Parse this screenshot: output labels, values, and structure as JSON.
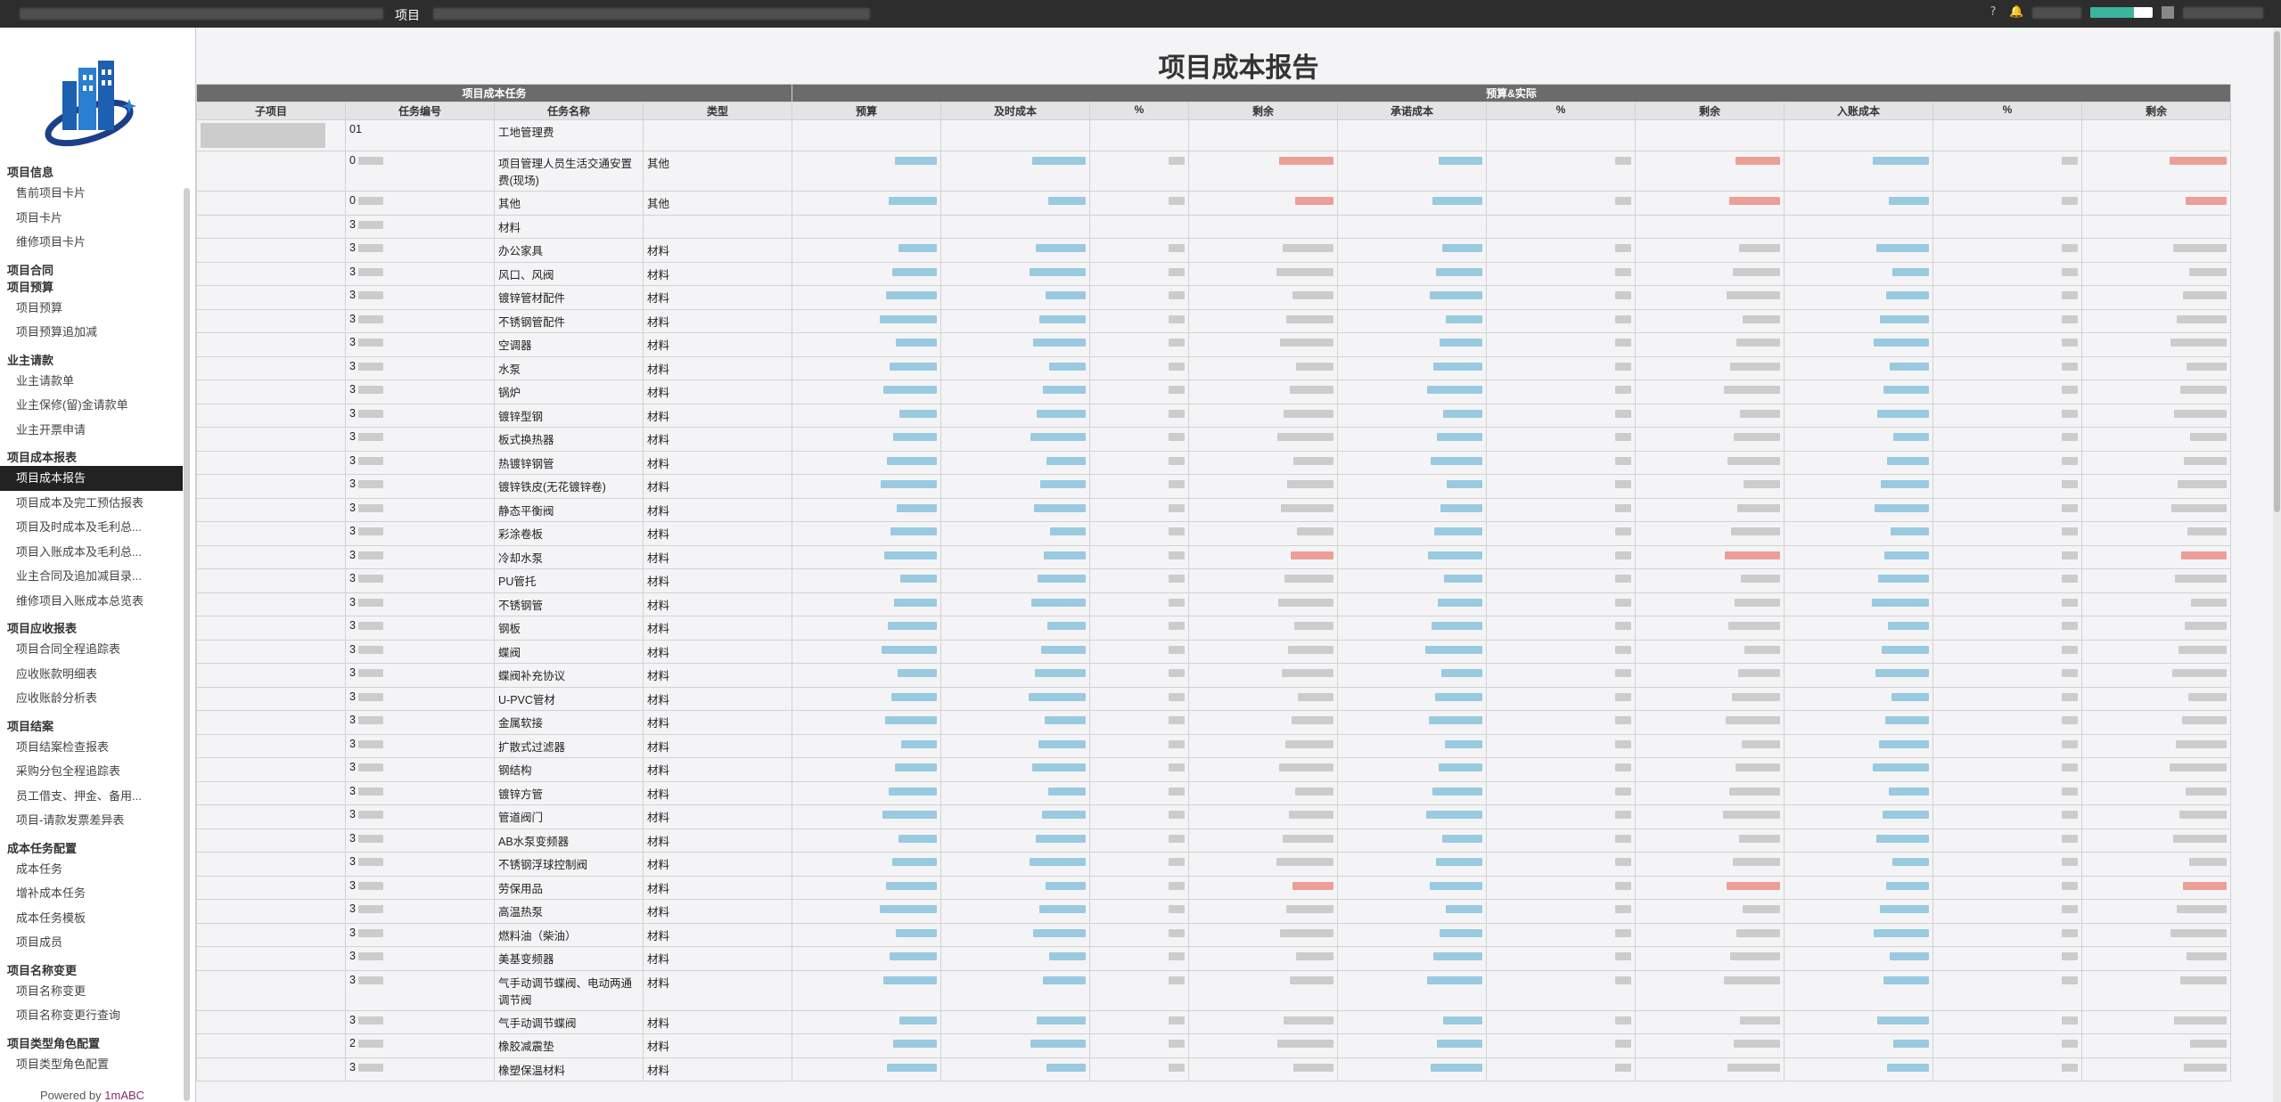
{
  "topbar": {
    "menu_label": "项目",
    "icons": [
      "help-icon",
      "bell-icon"
    ],
    "progress": 0.7
  },
  "sidebar": {
    "powered_by": "Powered by ",
    "brand": "1mABC",
    "groups": [
      {
        "title": "项目信息",
        "items": [
          "售前项目卡片",
          "项目卡片",
          "维修项目卡片"
        ]
      },
      {
        "title": "项目合同",
        "items": []
      },
      {
        "title": "项目预算",
        "items": [
          "项目预算",
          "项目预算追加减"
        ],
        "tight": true
      },
      {
        "title": "业主请款",
        "items": [
          "业主请款单",
          "业主保修(留)金请款单",
          "业主开票申请"
        ]
      },
      {
        "title": "项目成本报表",
        "items": [
          "项目成本报告",
          "项目成本及完工预估报表",
          "项目及时成本及毛利总...",
          "项目入账成本及毛利总...",
          "业主合同及追加减目录...",
          "维修项目入账成本总览表"
        ],
        "active": "项目成本报告"
      },
      {
        "title": "项目应收报表",
        "items": [
          "项目合同全程追踪表",
          "应收账款明细表",
          "应收账龄分析表"
        ]
      },
      {
        "title": "项目结案",
        "items": [
          "项目结案检查报表",
          "采购分包全程追踪表",
          "员工借支、押金、备用...",
          "项目-请款发票差异表"
        ]
      },
      {
        "title": "成本任务配置",
        "items": [
          "成本任务",
          "增补成本任务",
          "成本任务模板",
          "项目成员"
        ]
      },
      {
        "title": "项目名称变更",
        "items": [
          "项目名称变更",
          "项目名称变更行查询"
        ]
      },
      {
        "title": "项目类型角色配置",
        "items": [
          "项目类型角色配置"
        ]
      }
    ]
  },
  "report": {
    "title": "项目成本报告",
    "group_headers": {
      "left": "项目成本任务",
      "right": "预算&实际"
    },
    "columns": [
      "子项目",
      "任务编号",
      "任务名称",
      "类型",
      "预算",
      "及时成本",
      "%",
      "剩余",
      "承诺成本",
      "%",
      "剩余",
      "入账成本",
      "%",
      "剩余"
    ],
    "rows": [
      {
        "code": "01",
        "name": "工地管理费",
        "type": ""
      },
      {
        "code": "0",
        "name": "项目管理人员生活交通安置费(现场)",
        "type": "其他"
      },
      {
        "code": "0",
        "name": "其他",
        "type": "其他"
      },
      {
        "code": "3",
        "name": "材料",
        "type": ""
      },
      {
        "code": "3",
        "name": "办公家具",
        "type": "材料"
      },
      {
        "code": "3",
        "name": "风口、风阀",
        "type": "材料"
      },
      {
        "code": "3",
        "name": "镀锌管材配件",
        "type": "材料"
      },
      {
        "code": "3",
        "name": "不锈钢管配件",
        "type": "材料"
      },
      {
        "code": "3",
        "name": "空调器",
        "type": "材料"
      },
      {
        "code": "3",
        "name": "水泵",
        "type": "材料"
      },
      {
        "code": "3",
        "name": "锅炉",
        "type": "材料"
      },
      {
        "code": "3",
        "name": "镀锌型钢",
        "type": "材料"
      },
      {
        "code": "3",
        "name": "板式换热器",
        "type": "材料"
      },
      {
        "code": "3",
        "name": "热镀锌钢管",
        "type": "材料"
      },
      {
        "code": "3",
        "name": "镀锌铁皮(无花镀锌卷)",
        "type": "材料"
      },
      {
        "code": "3",
        "name": "静态平衡阀",
        "type": "材料"
      },
      {
        "code": "3",
        "name": "彩涂卷板",
        "type": "材料"
      },
      {
        "code": "3",
        "name": "冷却水泵",
        "type": "材料"
      },
      {
        "code": "3",
        "name": "PU管托",
        "type": "材料"
      },
      {
        "code": "3",
        "name": "不锈钢管",
        "type": "材料"
      },
      {
        "code": "3",
        "name": "钢板",
        "type": "材料"
      },
      {
        "code": "3",
        "name": "蝶阀",
        "type": "材料"
      },
      {
        "code": "3",
        "name": "蝶阀补充协议",
        "type": "材料"
      },
      {
        "code": "3",
        "name": "U-PVC管材",
        "type": "材料"
      },
      {
        "code": "3",
        "name": "金属软接",
        "type": "材料"
      },
      {
        "code": "3",
        "name": "扩散式过滤器",
        "type": "材料"
      },
      {
        "code": "3",
        "name": "钢结构",
        "type": "材料"
      },
      {
        "code": "3",
        "name": "镀锌方管",
        "type": "材料"
      },
      {
        "code": "3",
        "name": "管道阀门",
        "type": "材料"
      },
      {
        "code": "3",
        "name": "AB水泵变频器",
        "type": "材料"
      },
      {
        "code": "3",
        "name": "不锈钢浮球控制阀",
        "type": "材料"
      },
      {
        "code": "3",
        "name": "劳保用品",
        "type": "材料"
      },
      {
        "code": "3",
        "name": "高温热泵",
        "type": "材料"
      },
      {
        "code": "3",
        "name": "燃料油（柴油）",
        "type": "材料"
      },
      {
        "code": "3",
        "name": "美基变频器",
        "type": "材料"
      },
      {
        "code": "3",
        "name": "气手动调节蝶阀、电动两通调节阀",
        "type": "材料"
      },
      {
        "code": "3",
        "name": "气手动调节蝶阀",
        "type": "材料"
      },
      {
        "code": "2",
        "name": "橡胶减震垫",
        "type": "材料"
      },
      {
        "code": "3",
        "name": "橡塑保温材料",
        "type": "材料"
      }
    ]
  }
}
